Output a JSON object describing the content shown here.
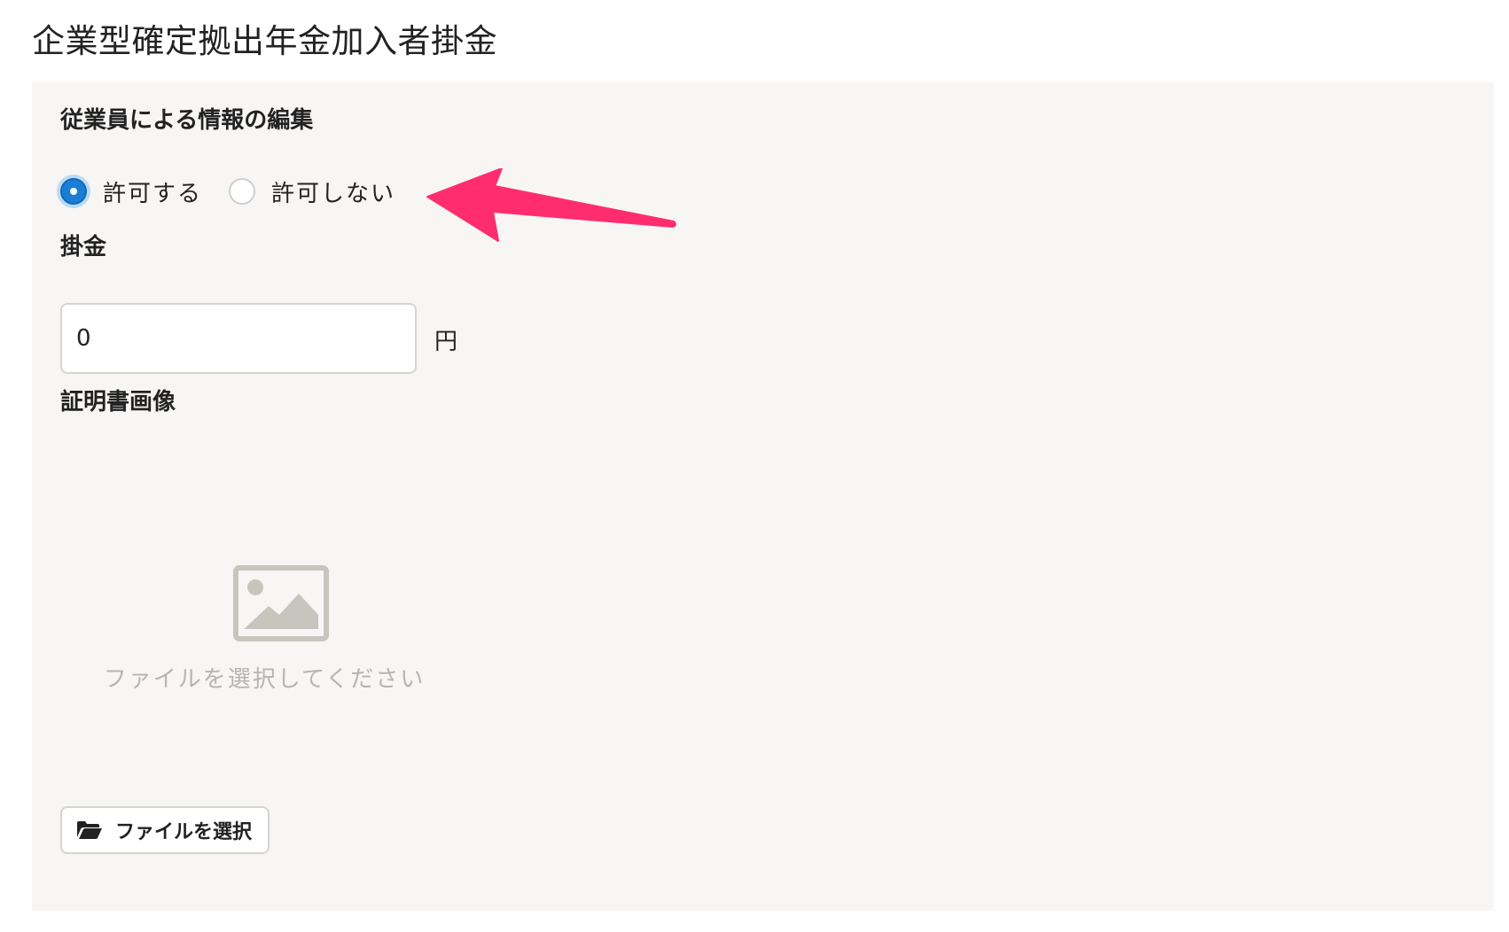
{
  "page": {
    "title": "企業型確定拠出年金加入者掛金"
  },
  "editing_permission": {
    "label": "従業員による情報の編集",
    "options": [
      {
        "label": "許可する",
        "selected": true
      },
      {
        "label": "許可しない",
        "selected": false
      }
    ]
  },
  "contribution": {
    "label": "掛金",
    "value": "0",
    "unit": "円"
  },
  "certificate": {
    "label": "証明書画像",
    "placeholder_icon": "image-icon",
    "placeholder_text": "ファイルを選択してください",
    "select_button_label": "ファイルを選択",
    "select_button_icon": "folder-open-icon"
  },
  "annotation": {
    "arrow_color": "#ff2d6f"
  },
  "colors": {
    "accent": "#1a7fd4",
    "panel_background": "#f7f6f5",
    "placeholder_text": "#b5b5b5"
  }
}
